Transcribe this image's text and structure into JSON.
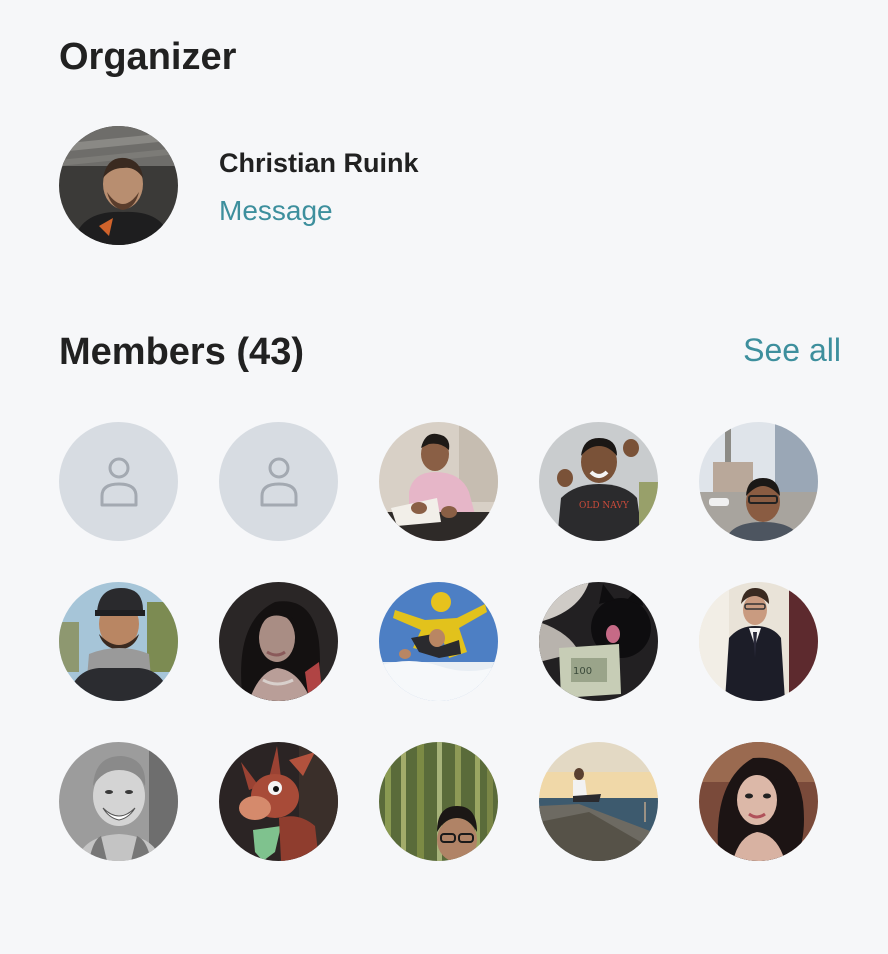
{
  "organizer": {
    "heading": "Organizer",
    "name": "Christian Ruink",
    "message_label": "Message"
  },
  "members": {
    "heading": "Members (43)",
    "see_all_label": "See all",
    "avatars": [
      {
        "icon": "user-placeholder-icon"
      },
      {
        "icon": "user-placeholder-icon"
      },
      {
        "icon": "member-photo"
      },
      {
        "icon": "member-photo"
      },
      {
        "icon": "member-photo"
      },
      {
        "icon": "member-photo"
      },
      {
        "icon": "member-photo"
      },
      {
        "icon": "member-photo"
      },
      {
        "icon": "member-photo"
      },
      {
        "icon": "member-photo"
      },
      {
        "icon": "member-photo"
      },
      {
        "icon": "member-photo"
      },
      {
        "icon": "member-photo"
      },
      {
        "icon": "member-photo"
      },
      {
        "icon": "member-photo"
      }
    ]
  },
  "colors": {
    "background": "#f6f7f9",
    "link": "#3d8f9d",
    "heading": "#212121",
    "placeholder": "#d7dce2"
  }
}
